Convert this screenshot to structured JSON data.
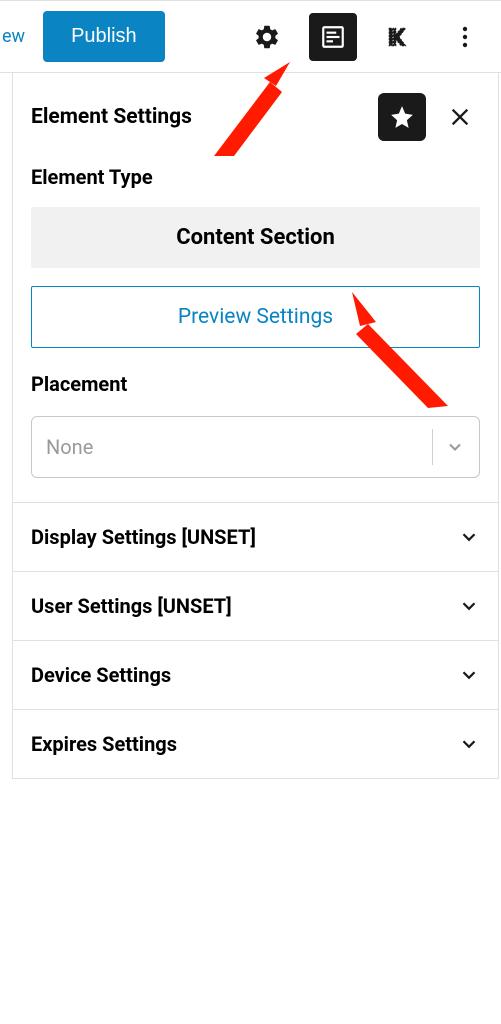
{
  "topbar": {
    "preview_fragment": "ew",
    "publish_label": "Publish"
  },
  "panel": {
    "title": "Element Settings",
    "section": {
      "element_type_label": "Element Type",
      "element_type_value": "Content Section",
      "preview_settings_label": "Preview Settings",
      "placement_label": "Placement",
      "placement_value": "None"
    },
    "accordions": [
      {
        "label": "Display Settings [UNSET]"
      },
      {
        "label": "User Settings [UNSET]"
      },
      {
        "label": "Device Settings"
      },
      {
        "label": "Expires Settings"
      }
    ]
  }
}
